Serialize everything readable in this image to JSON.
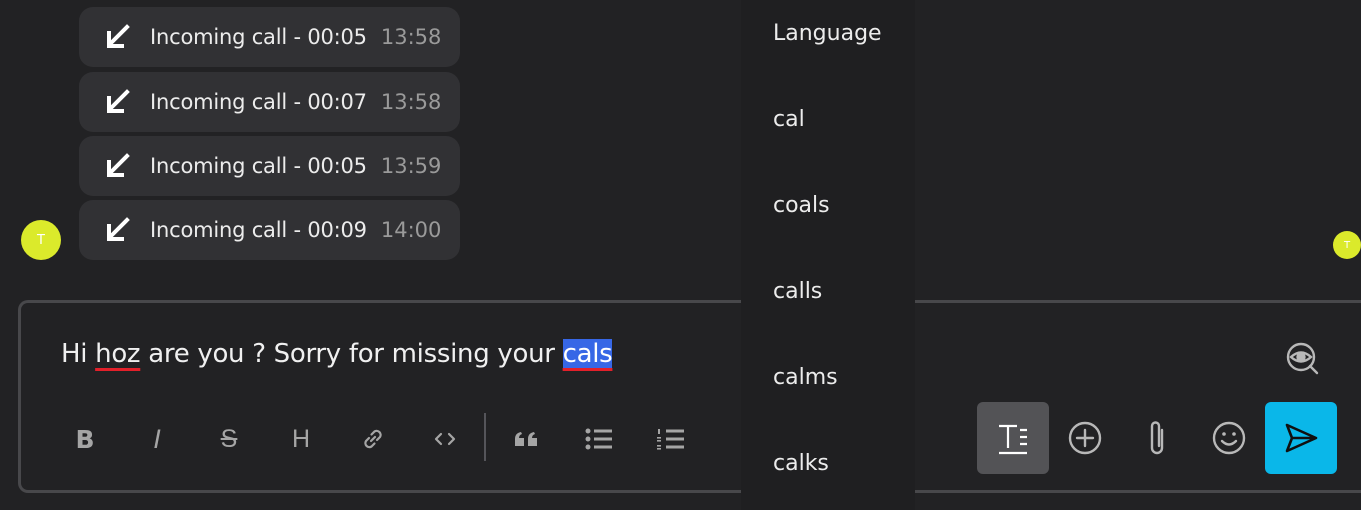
{
  "calls": [
    {
      "label": "Incoming call - 00:05",
      "time": "13:58"
    },
    {
      "label": "Incoming call - 00:07",
      "time": "13:58"
    },
    {
      "label": "Incoming call - 00:05",
      "time": "13:59"
    },
    {
      "label": "Incoming call - 00:09",
      "time": "14:00"
    }
  ],
  "avatar": {
    "initial": "T",
    "color": "#dbea2b"
  },
  "composer": {
    "text_parts": [
      "Hi ",
      "hoz",
      " are you ? Sorry for missing your ",
      "cals"
    ],
    "misspelled_words": [
      "hoz",
      "cals"
    ],
    "selected_word": "cals"
  },
  "formatting": {
    "bold": "B",
    "italic": "I",
    "strike": "S",
    "heading": "H"
  },
  "spellcheck_menu": {
    "header": "Language",
    "suggestions": [
      "cal",
      "coals",
      "calls",
      "calms",
      "calks"
    ]
  },
  "colors": {
    "background": "#222224",
    "bubble": "#313134",
    "send_button": "#0ab7e9",
    "selection": "#3767e6",
    "misspell_underline": "#e3202a"
  }
}
